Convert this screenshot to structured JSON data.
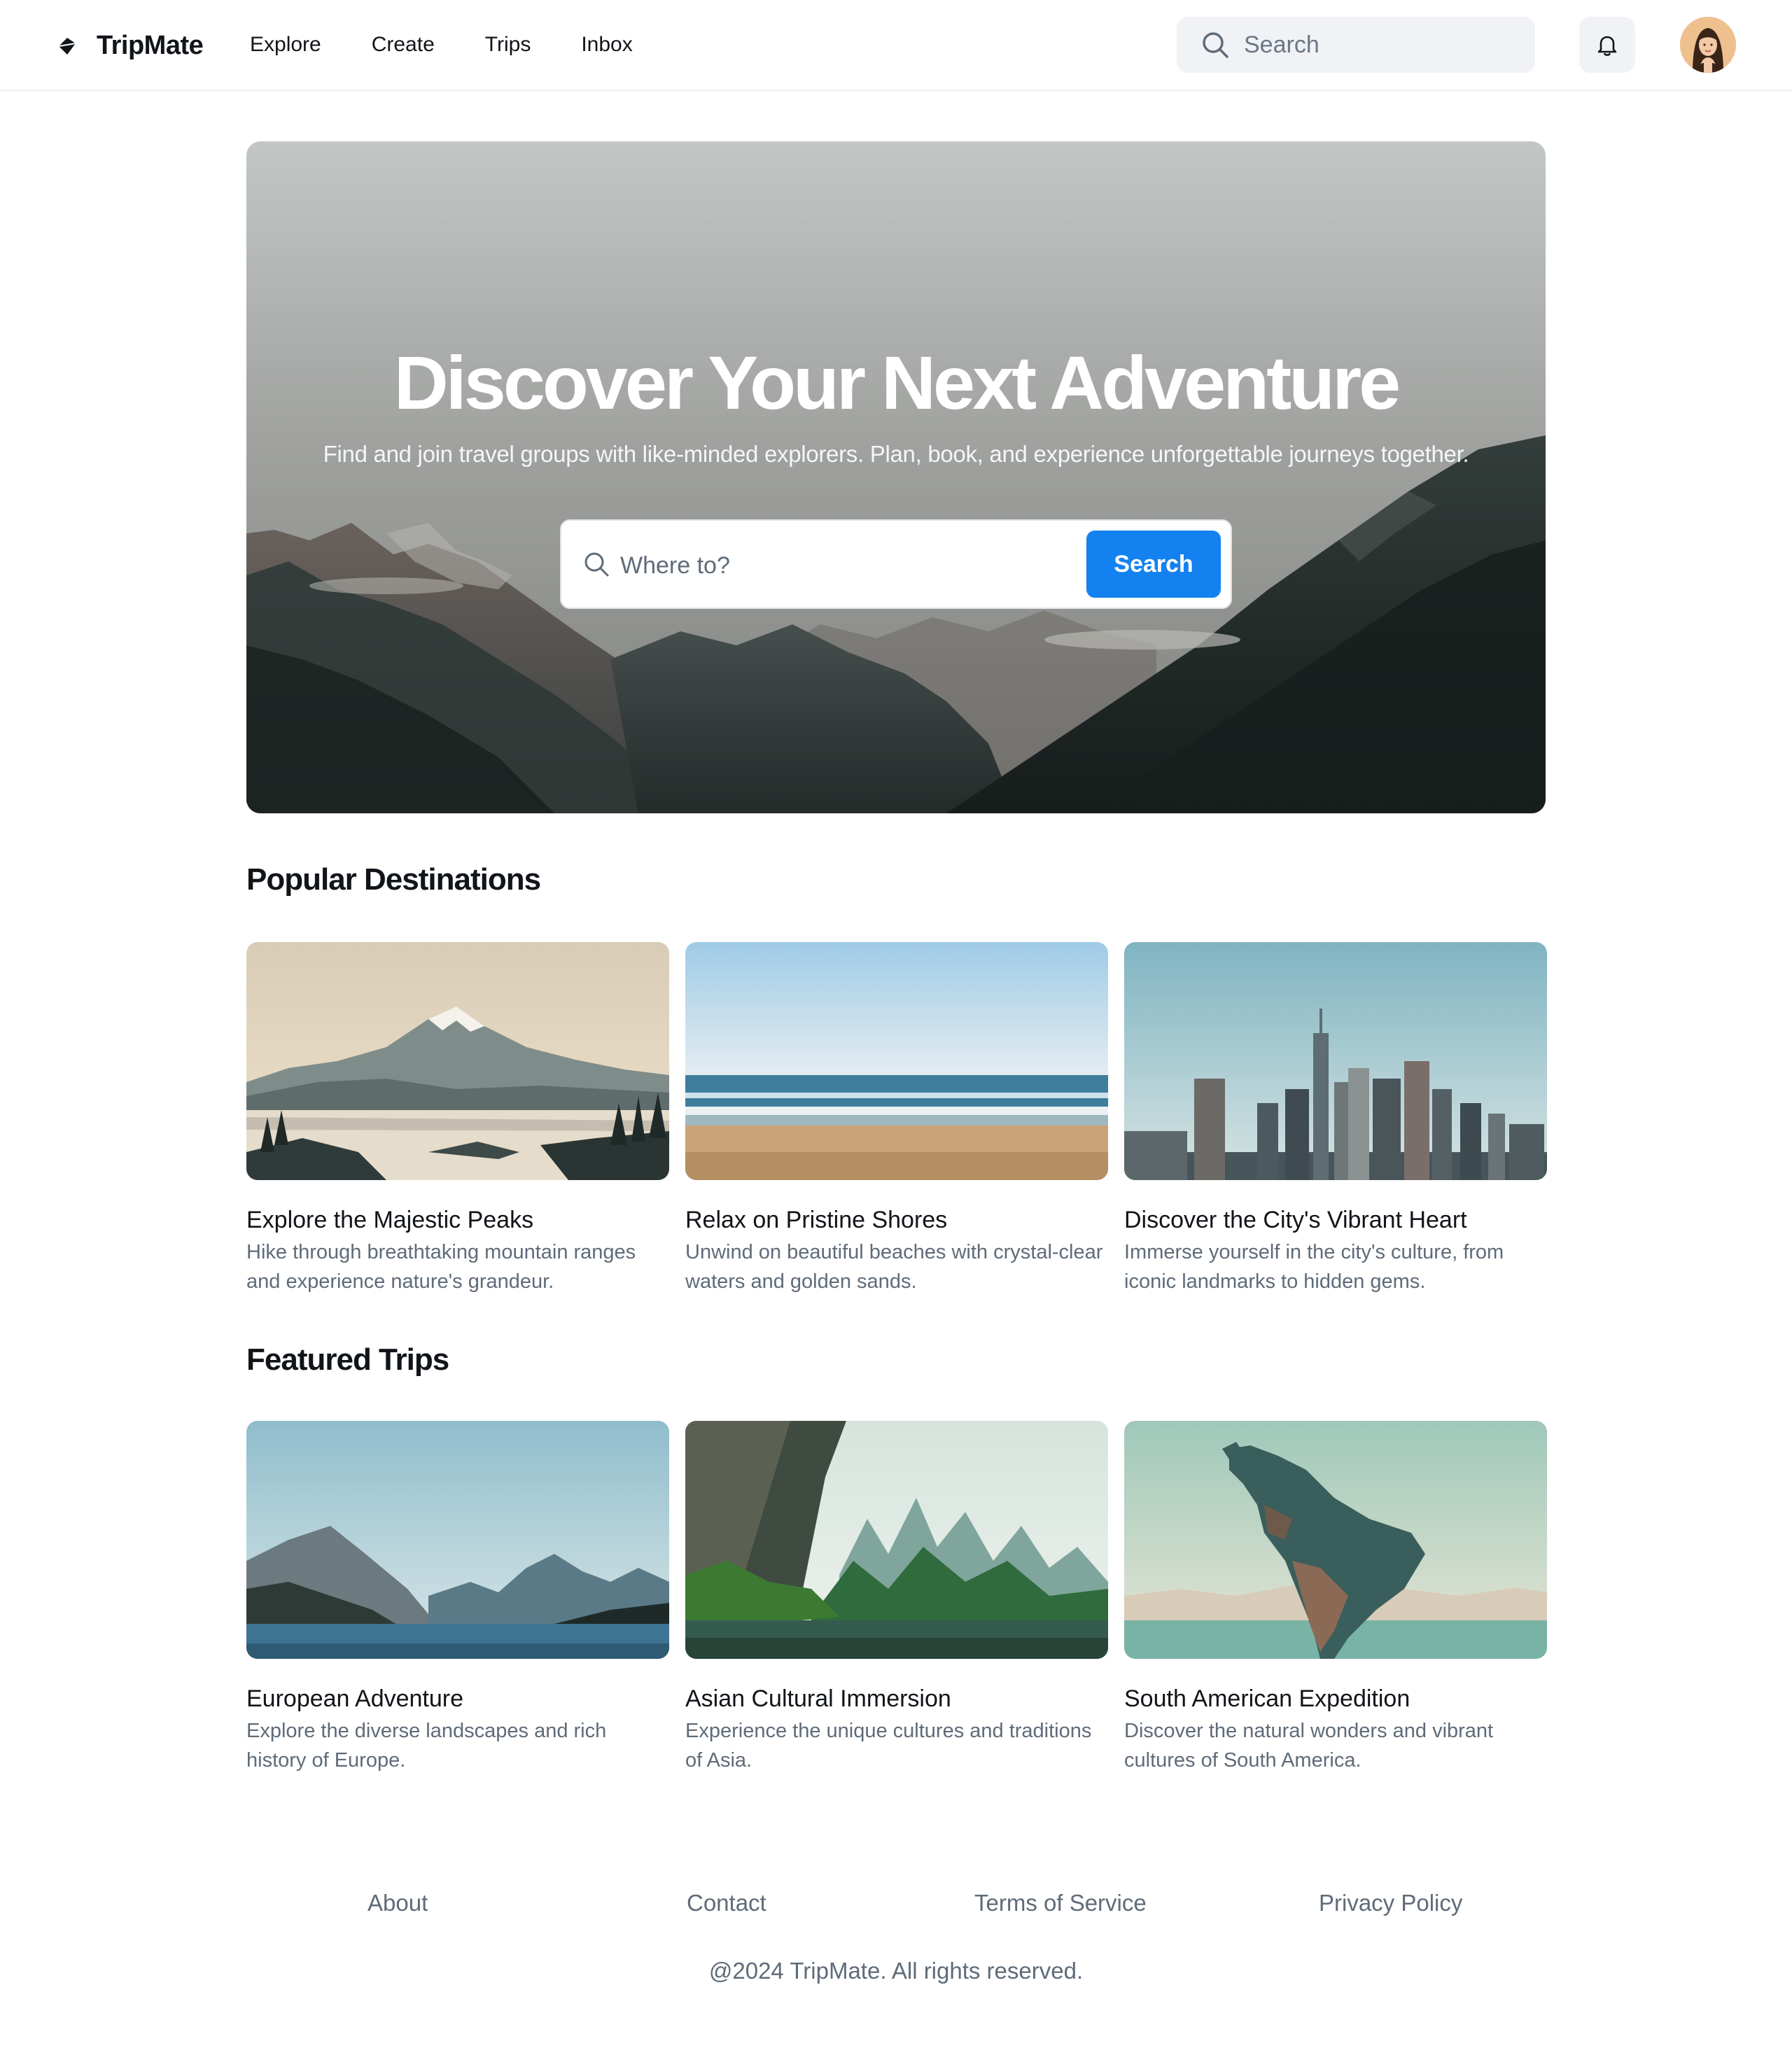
{
  "header": {
    "brand": "TripMate",
    "nav": [
      "Explore",
      "Create",
      "Trips",
      "Inbox"
    ],
    "search_placeholder": "Search",
    "notification_icon": "bell-icon",
    "avatar_icon": "user-avatar"
  },
  "hero": {
    "title": "Discover Your Next Adventure",
    "subtitle": "Find and join travel groups with like-minded explorers. Plan, book, and experience unforgettable journeys together.",
    "search_placeholder": "Where to?",
    "search_button": "Search"
  },
  "popular": {
    "title": "Popular Destinations",
    "items": [
      {
        "title": "Explore the Majestic Peaks",
        "desc": "Hike through breathtaking mountain ranges and experience nature's grandeur."
      },
      {
        "title": "Relax on Pristine Shores",
        "desc": "Unwind on beautiful beaches with crystal-clear waters and golden sands."
      },
      {
        "title": "Discover the City's Vibrant Heart",
        "desc": "Immerse yourself in the city's culture, from iconic landmarks to hidden gems."
      }
    ]
  },
  "featured": {
    "title": "Featured Trips",
    "items": [
      {
        "title": "European Adventure",
        "desc": "Explore the diverse landscapes and rich history of Europe."
      },
      {
        "title": "Asian Cultural Immersion",
        "desc": "Experience the unique cultures and traditions of Asia."
      },
      {
        "title": "South American Expedition",
        "desc": "Discover the natural wonders and vibrant cultures of South America."
      }
    ]
  },
  "footer": {
    "links": [
      "About",
      "Contact",
      "Terms of Service",
      "Privacy Policy"
    ],
    "copyright": "@2024 TripMate. All rights reserved."
  },
  "colors": {
    "accent": "#1382f0",
    "muted_text": "#5f6b78",
    "surface": "#f0f2f5"
  }
}
